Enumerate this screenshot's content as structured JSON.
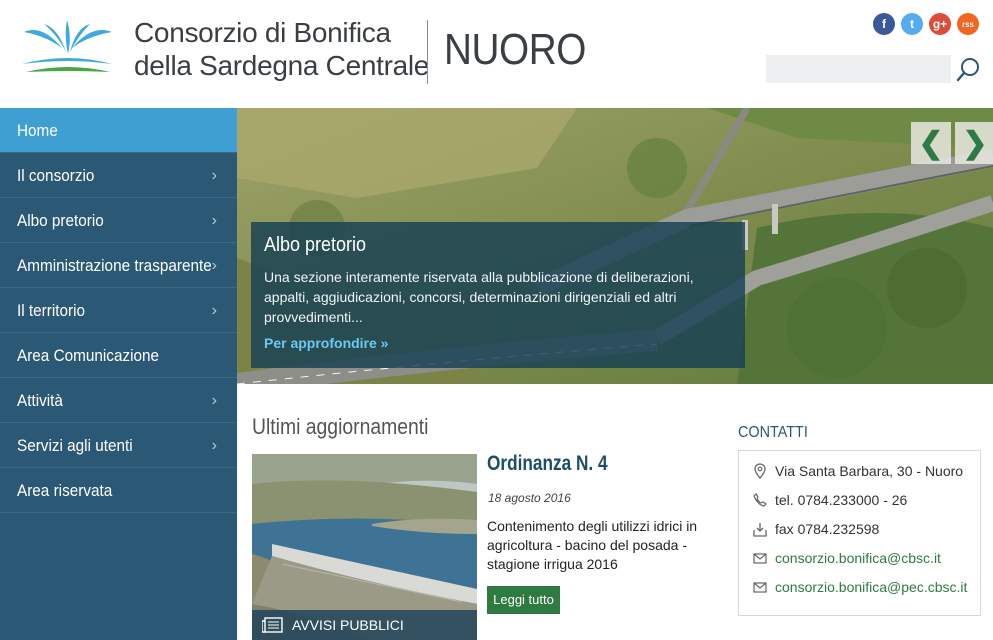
{
  "header": {
    "org_name_line1": "Consorzio di Bonifica",
    "org_name_line2": "della Sardegna Centrale",
    "city": "NUORO",
    "socials": [
      {
        "name": "facebook",
        "glyph": "f",
        "color": "#3b5998"
      },
      {
        "name": "twitter",
        "glyph": "t",
        "color": "#55acee"
      },
      {
        "name": "google-plus",
        "glyph": "g+",
        "color": "#dd4b39"
      },
      {
        "name": "rss",
        "glyph": "rss",
        "color": "#f26522"
      }
    ],
    "search": {
      "placeholder": "",
      "value": ""
    }
  },
  "sidebar": {
    "items": [
      {
        "label": "Home",
        "active": true,
        "has_submenu": false
      },
      {
        "label": "Il consorzio",
        "active": false,
        "has_submenu": true
      },
      {
        "label": "Albo pretorio",
        "active": false,
        "has_submenu": true
      },
      {
        "label": "Amministrazione trasparente",
        "active": false,
        "has_submenu": true
      },
      {
        "label": "Il territorio",
        "active": false,
        "has_submenu": true
      },
      {
        "label": "Area Comunicazione",
        "active": false,
        "has_submenu": false
      },
      {
        "label": "Attività",
        "active": false,
        "has_submenu": true
      },
      {
        "label": "Servizi agli utenti",
        "active": false,
        "has_submenu": true
      },
      {
        "label": "Area riservata",
        "active": false,
        "has_submenu": false
      }
    ]
  },
  "hero": {
    "title": "Albo pretorio",
    "text": "Una sezione interamente riservata alla pubblicazione di deliberazioni, appalti, aggiudicazioni, concorsi, determinazioni dirigenziali ed altri provvedimenti...",
    "link": "Per approfondire »",
    "prev_glyph": "❮",
    "next_glyph": "❯"
  },
  "updates": {
    "heading": "Ultimi aggiornamenti",
    "item": {
      "category": "AVVISI PUBBLICI",
      "title": "Ordinanza N. 4",
      "date": "18 agosto 2016",
      "description": "Contenimento degli utilizzi idrici in agricoltura - bacino del posada - stagione irrigua 2016",
      "button": "Leggi tutto"
    }
  },
  "contacts": {
    "heading": "CONTATTI",
    "address": "Via Santa Barbara, 30 - Nuoro",
    "tel": "tel. 0784.233000 - 26",
    "fax": "fax 0784.232598",
    "email1": "consorzio.bonifica@cbsc.it",
    "email2": "consorzio.bonifica@pec.cbsc.it"
  },
  "colors": {
    "sidebar": "#2b5975",
    "sidebar_active": "#3f9fd2",
    "accent_green": "#2f7a40",
    "link_blue": "#6cc8f3"
  }
}
